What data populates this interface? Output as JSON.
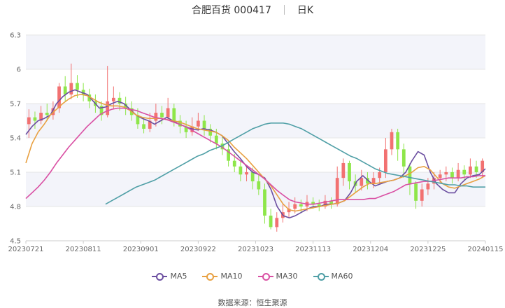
{
  "chart_data": {
    "type": "candlestick",
    "title_name": "合肥百货 000417",
    "title_period": "日K",
    "ylim": [
      4.5,
      6.3
    ],
    "y_ticks": [
      "4.5",
      "4.8",
      "5.1",
      "5.4",
      "5.7",
      "6",
      "6.3"
    ],
    "x_ticks": [
      "20230721",
      "20230811",
      "20230901",
      "20230922",
      "20231023",
      "20231113",
      "20231204",
      "20231225",
      "20240115"
    ],
    "grid": true,
    "legend_position": "bottom",
    "source": "数据来源：恒生聚源",
    "colors": {
      "up": "#f27171",
      "down": "#8ee64a",
      "grid": "#e6e6e6",
      "band": "#f3f4fa"
    },
    "series": [
      {
        "name": "MA5",
        "color": "#6b4ea0",
        "values": [
          5.43,
          5.5,
          5.55,
          5.57,
          5.6,
          5.7,
          5.76,
          5.8,
          5.82,
          5.8,
          5.78,
          5.72,
          5.66,
          5.67,
          5.7,
          5.72,
          5.7,
          5.65,
          5.6,
          5.57,
          5.55,
          5.52,
          5.55,
          5.58,
          5.55,
          5.52,
          5.5,
          5.48,
          5.47,
          5.48,
          5.47,
          5.45,
          5.42,
          5.35,
          5.28,
          5.22,
          5.15,
          5.1,
          5.08,
          5.05,
          4.95,
          4.8,
          4.72,
          4.7,
          4.72,
          4.75,
          4.78,
          4.8,
          4.8,
          4.82,
          4.82,
          4.83,
          4.85,
          4.92,
          5.02,
          5.07,
          5.02,
          4.98,
          5.0,
          5.02,
          5.03,
          5.05,
          5.1,
          5.2,
          5.28,
          5.25,
          5.1,
          5.0,
          4.95,
          4.92,
          4.92,
          5.0,
          5.05,
          5.07,
          5.08,
          5.13
        ]
      },
      {
        "name": "MA10",
        "color": "#e8a041",
        "values": [
          5.18,
          5.35,
          5.45,
          5.52,
          5.6,
          5.65,
          5.7,
          5.74,
          5.77,
          5.78,
          5.77,
          5.74,
          5.71,
          5.69,
          5.68,
          5.68,
          5.67,
          5.64,
          5.6,
          5.58,
          5.57,
          5.57,
          5.57,
          5.56,
          5.55,
          5.54,
          5.52,
          5.5,
          5.48,
          5.47,
          5.46,
          5.45,
          5.42,
          5.38,
          5.32,
          5.27,
          5.22,
          5.16,
          5.1,
          5.04,
          4.98,
          4.9,
          4.82,
          4.77,
          4.76,
          4.77,
          4.78,
          4.79,
          4.8,
          4.81,
          4.82,
          4.83,
          4.85,
          4.89,
          4.93,
          4.97,
          5.0,
          5.0,
          5.01,
          5.02,
          5.03,
          5.05,
          5.07,
          5.1,
          5.14,
          5.15,
          5.12,
          5.06,
          5.0,
          4.97,
          4.96,
          4.98,
          5.0,
          5.02,
          5.04,
          5.07
        ]
      },
      {
        "name": "MA30",
        "color": "#d94fa3",
        "values": [
          4.87,
          4.92,
          4.97,
          5.03,
          5.1,
          5.18,
          5.25,
          5.32,
          5.38,
          5.44,
          5.5,
          5.55,
          5.6,
          5.63,
          5.65,
          5.66,
          5.66,
          5.65,
          5.64,
          5.62,
          5.6,
          5.58,
          5.57,
          5.56,
          5.54,
          5.52,
          5.5,
          5.47,
          5.44,
          5.41,
          5.38,
          5.35,
          5.32,
          5.28,
          5.24,
          5.2,
          5.16,
          5.12,
          5.08,
          5.04,
          4.99,
          4.94,
          4.9,
          4.86,
          4.84,
          4.83,
          4.82,
          4.82,
          4.83,
          4.84,
          4.85,
          4.86,
          4.86,
          4.86,
          4.86,
          4.86,
          4.87,
          4.87,
          4.89,
          4.91,
          4.93,
          4.96,
          4.99,
          5.0,
          5.01,
          5.02,
          5.02,
          5.03,
          5.04,
          5.05,
          5.05,
          5.05,
          5.06,
          5.06,
          5.07,
          5.07
        ]
      },
      {
        "name": "MA60",
        "color": "#4f9fa6",
        "values": [
          4.82,
          4.85,
          4.88,
          4.91,
          4.94,
          4.97,
          4.99,
          5.01,
          5.03,
          5.06,
          5.09,
          5.12,
          5.15,
          5.18,
          5.21,
          5.24,
          5.26,
          5.29,
          5.31,
          5.33,
          5.36,
          5.39,
          5.42,
          5.45,
          5.48,
          5.5,
          5.52,
          5.53,
          5.53,
          5.53,
          5.52,
          5.5,
          5.48,
          5.45,
          5.42,
          5.39,
          5.36,
          5.33,
          5.3,
          5.27,
          5.24,
          5.22,
          5.19,
          5.16,
          5.13,
          5.11,
          5.09,
          5.08,
          5.07,
          5.06,
          5.05,
          5.04,
          5.03,
          5.02,
          5.01,
          5.0,
          4.99,
          4.99,
          4.98,
          4.98,
          4.97,
          4.97,
          4.97
        ]
      }
    ],
    "ma60_offset": 13,
    "candles": [
      [
        5.52,
        5.58,
        5.65,
        5.4
      ],
      [
        5.58,
        5.55,
        5.63,
        5.48
      ],
      [
        5.55,
        5.62,
        5.68,
        5.52
      ],
      [
        5.62,
        5.6,
        5.7,
        5.55
      ],
      [
        5.6,
        5.66,
        5.72,
        5.56
      ],
      [
        5.66,
        5.85,
        5.88,
        5.62
      ],
      [
        5.85,
        5.78,
        5.94,
        5.72
      ],
      [
        5.78,
        5.88,
        6.05,
        5.74
      ],
      [
        5.88,
        5.82,
        5.95,
        5.75
      ],
      [
        5.82,
        5.78,
        5.88,
        5.72
      ],
      [
        5.78,
        5.72,
        5.83,
        5.66
      ],
      [
        5.72,
        5.68,
        5.78,
        5.62
      ],
      [
        5.68,
        5.6,
        5.72,
        5.55
      ],
      [
        5.6,
        5.72,
        6.03,
        5.58
      ],
      [
        5.72,
        5.75,
        5.85,
        5.65
      ],
      [
        5.75,
        5.7,
        5.8,
        5.64
      ],
      [
        5.7,
        5.66,
        5.76,
        5.6
      ],
      [
        5.66,
        5.6,
        5.72,
        5.55
      ],
      [
        5.6,
        5.52,
        5.66,
        5.48
      ],
      [
        5.52,
        5.48,
        5.58,
        5.44
      ],
      [
        5.48,
        5.55,
        5.62,
        5.45
      ],
      [
        5.55,
        5.62,
        5.7,
        5.5
      ],
      [
        5.62,
        5.58,
        5.68,
        5.52
      ],
      [
        5.58,
        5.66,
        5.75,
        5.55
      ],
      [
        5.66,
        5.55,
        5.7,
        5.5
      ],
      [
        5.55,
        5.5,
        5.6,
        5.44
      ],
      [
        5.5,
        5.45,
        5.55,
        5.4
      ],
      [
        5.45,
        5.5,
        5.58,
        5.42
      ],
      [
        5.5,
        5.55,
        5.62,
        5.46
      ],
      [
        5.55,
        5.48,
        5.6,
        5.42
      ],
      [
        5.48,
        5.42,
        5.52,
        5.36
      ],
      [
        5.42,
        5.35,
        5.48,
        5.3
      ],
      [
        5.35,
        5.3,
        5.42,
        5.25
      ],
      [
        5.3,
        5.2,
        5.36,
        5.15
      ],
      [
        5.2,
        5.15,
        5.26,
        5.1
      ],
      [
        5.15,
        5.08,
        5.2,
        5.02
      ],
      [
        5.08,
        5.1,
        5.16,
        5.02
      ],
      [
        5.1,
        5.02,
        5.14,
        4.95
      ],
      [
        5.02,
        4.95,
        5.08,
        4.9
      ],
      [
        4.95,
        4.72,
        5.0,
        4.65
      ],
      [
        4.72,
        4.62,
        4.78,
        4.6
      ],
      [
        4.62,
        4.7,
        4.75,
        4.58
      ],
      [
        4.7,
        4.75,
        4.82,
        4.66
      ],
      [
        4.75,
        4.78,
        4.84,
        4.7
      ],
      [
        4.78,
        4.82,
        4.88,
        4.74
      ],
      [
        4.82,
        4.8,
        4.86,
        4.75
      ],
      [
        4.8,
        4.84,
        4.9,
        4.76
      ],
      [
        4.84,
        4.82,
        4.88,
        4.78
      ],
      [
        4.82,
        4.8,
        4.86,
        4.76
      ],
      [
        4.8,
        4.85,
        4.9,
        4.78
      ],
      [
        4.85,
        4.82,
        4.88,
        4.78
      ],
      [
        4.82,
        5.05,
        5.15,
        4.8
      ],
      [
        5.05,
        5.18,
        5.22,
        4.98
      ],
      [
        5.18,
        5.02,
        5.2,
        4.95
      ],
      [
        5.02,
        4.98,
        5.08,
        4.92
      ],
      [
        4.98,
        5.05,
        5.12,
        4.94
      ],
      [
        5.05,
        5.0,
        5.1,
        4.95
      ],
      [
        5.0,
        5.05,
        5.1,
        4.96
      ],
      [
        5.05,
        5.1,
        5.14,
        5.0
      ],
      [
        5.1,
        5.3,
        5.4,
        5.05
      ],
      [
        5.3,
        5.45,
        5.48,
        5.25
      ],
      [
        5.45,
        5.3,
        5.48,
        5.2
      ],
      [
        5.3,
        5.15,
        5.35,
        5.05
      ],
      [
        5.15,
        5.0,
        5.18,
        4.9
      ],
      [
        5.0,
        4.85,
        5.02,
        4.78
      ],
      [
        4.85,
        4.95,
        5.0,
        4.8
      ],
      [
        4.95,
        5.0,
        5.05,
        4.9
      ],
      [
        5.0,
        5.05,
        5.1,
        4.95
      ],
      [
        5.05,
        5.08,
        5.12,
        5.0
      ],
      [
        5.08,
        5.1,
        5.15,
        5.02
      ],
      [
        5.1,
        5.05,
        5.14,
        5.0
      ],
      [
        5.05,
        5.12,
        5.18,
        5.02
      ],
      [
        5.12,
        5.08,
        5.16,
        5.03
      ],
      [
        5.08,
        5.15,
        5.22,
        5.05
      ],
      [
        5.15,
        5.1,
        5.2,
        5.05
      ],
      [
        5.1,
        5.2,
        5.22,
        5.05
      ]
    ]
  }
}
